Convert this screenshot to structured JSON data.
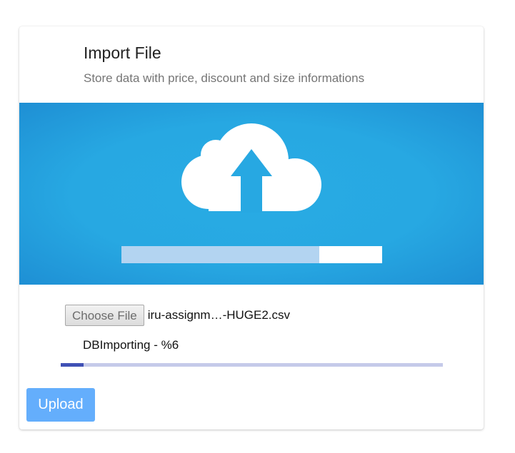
{
  "card": {
    "title": "Import File",
    "subtitle": "Store data with price, discount and size informations"
  },
  "hero": {
    "icon": "cloud-upload-icon",
    "background_color": "#27a8e2",
    "illustration_progress": 0.76
  },
  "file_input": {
    "button_label": "Choose File",
    "file_name": "iru-assignm…-HUGE2.csv"
  },
  "status": {
    "text": "DBImporting - %6",
    "progress_percent": 6,
    "track_color": "#c5cae9",
    "fill_color": "#3f51b5"
  },
  "actions": {
    "upload_label": "Upload",
    "upload_color": "#64aefc"
  }
}
